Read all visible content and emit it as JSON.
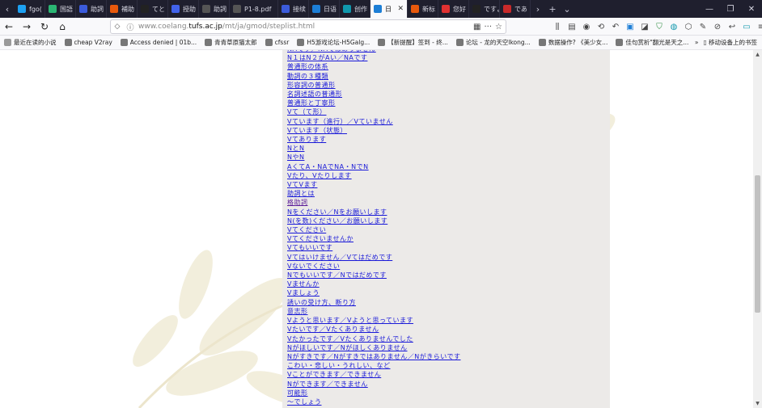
{
  "tabs": [
    {
      "label": "fgo(",
      "icon_color": "#1da1f2"
    },
    {
      "label": "国語",
      "icon_color": "#2bb673"
    },
    {
      "label": "助詞",
      "icon_color": "#3b5bdb"
    },
    {
      "label": "補助",
      "icon_color": "#e8590c"
    },
    {
      "label": "てと",
      "icon_color": "#222222"
    },
    {
      "label": "授助",
      "icon_color": "#4263eb"
    },
    {
      "label": "助詞",
      "icon_color": "#555555"
    },
    {
      "label": "P1-8.pdf",
      "icon_color": "#555555"
    },
    {
      "label": "接续",
      "icon_color": "#3b5bdb"
    },
    {
      "label": "日语",
      "icon_color": "#1c7ed6"
    },
    {
      "label": "创作",
      "icon_color": "#1098ad"
    },
    {
      "label": "日",
      "icon_color": "#1c7ed6"
    },
    {
      "label": "新标",
      "icon_color": "#e8590c"
    },
    {
      "label": "您好",
      "icon_color": "#e03131"
    },
    {
      "label": "ですよ",
      "icon_color": "#222222"
    },
    {
      "label": "であ",
      "icon_color": "#c92a2a"
    }
  ],
  "url": {
    "prefix": "www.coelang.",
    "domain": "tufs.ac.jp",
    "path": "/mt/ja/gmod/steplist.html"
  },
  "bookmarks": [
    "最近在读的小说",
    "cheap V2ray",
    "Access denied | 01b...",
    "青青草原猫太郎",
    "cfssr",
    "H5游戏论坛-H5Galg...",
    "【新提醒】签到 - 终...",
    "论坛 - 龙的天空lkong...",
    "数据操作? 《美少女...",
    "佳句赏析\"翻光是天之..."
  ],
  "bookmarks_more": "移动设备上的书签",
  "links": [
    {
      "text": "NAです／NAではありません",
      "visited": false
    },
    {
      "text": "N１はN２がAい／NAです",
      "visited": false
    },
    {
      "text": "普通形の体系",
      "visited": false
    },
    {
      "text": "動詞の３種類",
      "visited": false
    },
    {
      "text": "形容詞の普通形",
      "visited": false
    },
    {
      "text": "名詞述語の普通形",
      "visited": false
    },
    {
      "text": "普通形と丁寧形",
      "visited": false
    },
    {
      "text": "Vて（て形）",
      "visited": false
    },
    {
      "text": "Vています（進行）／Vていません",
      "visited": false
    },
    {
      "text": "Vています（状態）",
      "visited": false
    },
    {
      "text": "Vてあります",
      "visited": false
    },
    {
      "text": "NとN",
      "visited": false
    },
    {
      "text": "NやN",
      "visited": false
    },
    {
      "text": "AくてA・NAでNA・NでN",
      "visited": false
    },
    {
      "text": "Vたり、Vたりします",
      "visited": false
    },
    {
      "text": "VてVます",
      "visited": false
    },
    {
      "text": "助詞とは",
      "visited": false
    },
    {
      "text": "格助詞",
      "visited": true
    },
    {
      "text": "Nをください／Nをお願いします",
      "visited": false
    },
    {
      "text": "N(を数)ください／お願いします",
      "visited": false
    },
    {
      "text": "Vてください",
      "visited": false
    },
    {
      "text": "Vてくださいませんか",
      "visited": false
    },
    {
      "text": "Vてもいいです",
      "visited": false
    },
    {
      "text": "Vてはいけません／Vてはだめです",
      "visited": false
    },
    {
      "text": "Vないでください",
      "visited": false
    },
    {
      "text": "Nでもいいです／Nではだめです",
      "visited": false
    },
    {
      "text": "Vませんか",
      "visited": false
    },
    {
      "text": "Vましょう",
      "visited": false
    },
    {
      "text": "誘いの受け方、断り方",
      "visited": false
    },
    {
      "text": "意志形",
      "visited": false
    },
    {
      "text": "Vようと思います／Vようと思っています",
      "visited": false
    },
    {
      "text": "Vたいです／Vたくありません",
      "visited": false
    },
    {
      "text": "Vたかったです／Vたくありませんでした",
      "visited": false
    },
    {
      "text": "Nがほしいです／Nがほしくありません",
      "visited": false
    },
    {
      "text": "Nがすきです／Nがすきではありません／Nがきらいです",
      "visited": false
    },
    {
      "text": "こわい・悲しい・うれしい、など",
      "visited": false
    },
    {
      "text": "Vことができます／できません",
      "visited": false
    },
    {
      "text": "Nができます／できません",
      "visited": false
    },
    {
      "text": "可能形",
      "visited": false
    },
    {
      "text": "〜でしょう",
      "visited": false
    }
  ]
}
